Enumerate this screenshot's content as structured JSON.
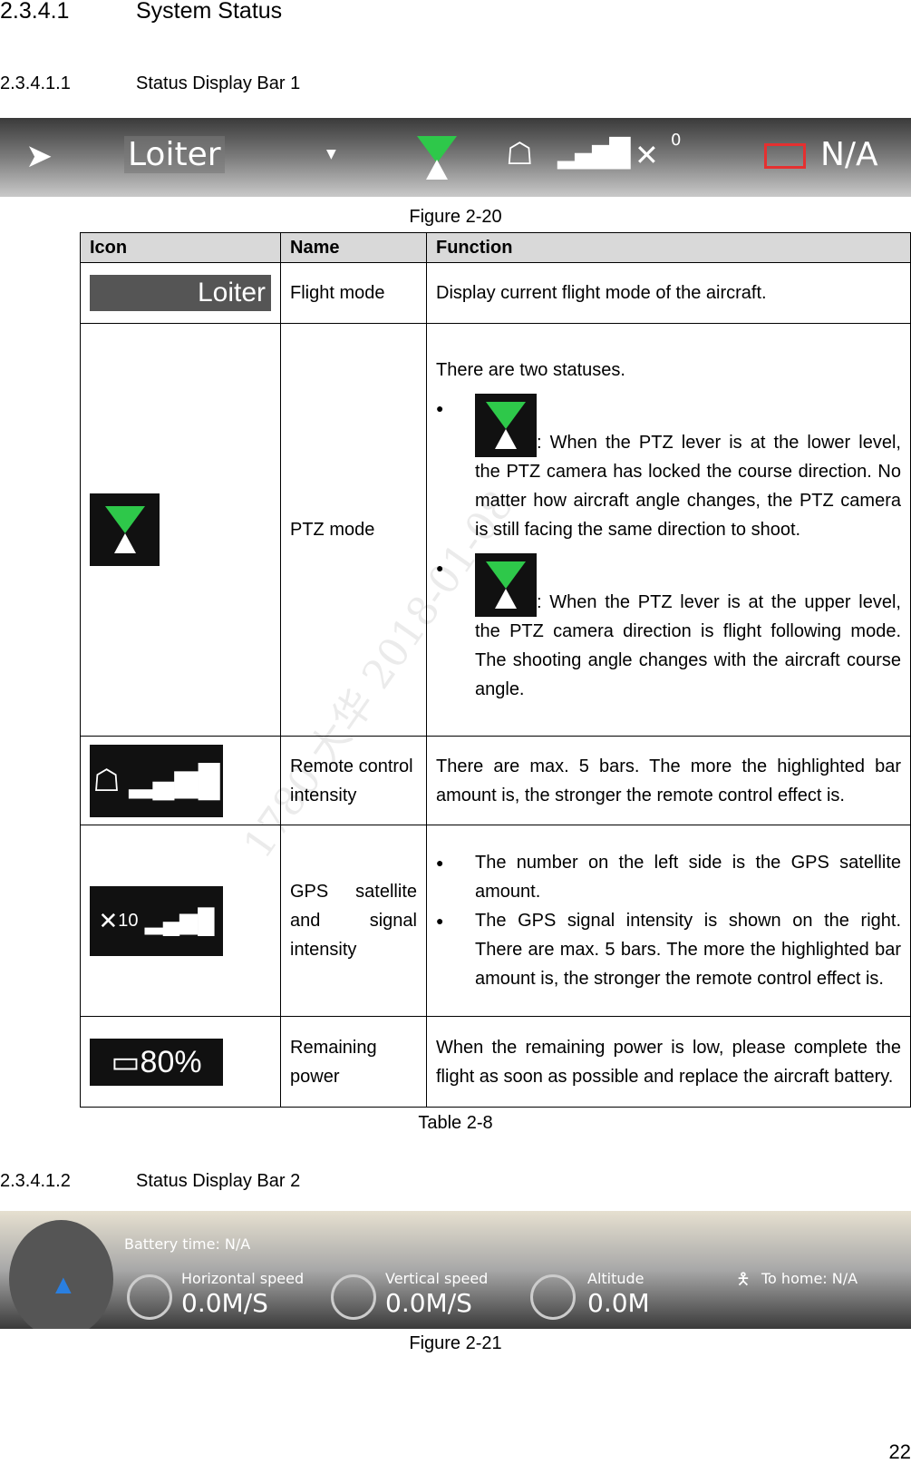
{
  "heading": {
    "number": "2.3.4.1",
    "title": "System Status"
  },
  "sub1": {
    "number": "2.3.4.1.1",
    "title": "Status Display Bar 1"
  },
  "bar1": {
    "mode": "Loiter",
    "rc_icon": "remote-control-icon",
    "gps_count": "0",
    "battery": "N/A",
    "colors": {
      "ptz": "#2ec84a",
      "battery": "#e53030"
    }
  },
  "fig1": "Figure 2-20",
  "table": {
    "headers": [
      "Icon",
      "Name",
      "Function"
    ],
    "rows": [
      {
        "icon_text": "Loiter",
        "name": "Flight mode",
        "function": "Display current flight mode of the aircraft."
      },
      {
        "name": "PTZ mode",
        "intro": "There are two statuses.",
        "b1": ": When the PTZ lever is at the lower level, the PTZ camera has locked the course direction. No matter how aircraft angle changes, the PTZ camera is still facing the same direction to shoot.",
        "b2": ": When the PTZ lever is at the upper level, the PTZ camera direction is flight following mode. The shooting angle changes with the aircraft course angle."
      },
      {
        "name": "Remote control intensity",
        "function": "There are max. 5 bars. The more the highlighted bar amount is, the stronger the remote control effect is."
      },
      {
        "icon_text": "10",
        "name": "GPS satellite and signal intensity",
        "b1": "The number on the left side is the GPS satellite amount.",
        "b2": "The GPS signal intensity is shown on the right. There are max. 5 bars. The more the highlighted bar amount is, the stronger the remote control effect is."
      },
      {
        "icon_text": "80%",
        "name": "Remaining power",
        "function": "When the remaining power is low, please complete the flight as soon as possible and replace the aircraft battery."
      }
    ]
  },
  "table_caption": "Table 2-8",
  "sub2": {
    "number": "2.3.4.1.2",
    "title": "Status Display Bar 2"
  },
  "bar2": {
    "battery_time": "Battery time: N/A",
    "hspeed_label": "Horizontal speed",
    "hspeed": "0.0M/S",
    "vspeed_label": "Vertical speed",
    "vspeed": "0.0M/S",
    "alt_label": "Altitude",
    "alt": "0.0M",
    "home": "To home: N/A"
  },
  "fig2": "Figure 2-21",
  "page_number": "22",
  "watermark": "1780 大华 2018-01-08"
}
